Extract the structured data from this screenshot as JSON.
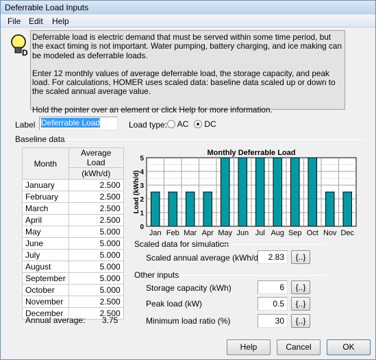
{
  "window": {
    "title": "Deferrable Load Inputs"
  },
  "menu": [
    "File",
    "Edit",
    "Help"
  ],
  "description": {
    "p1": "Deferrable load is electric demand that must be served within some time period, but the exact timing is not important. Water pumping, battery charging, and ice making can be modeled as deferrable loads.",
    "p2": "Enter 12 monthly values of average deferrable load, the storage capacity, and peak load. For calculations, HOMER uses scaled data: baseline data scaled up or down to the scaled annual average value.",
    "p3": "Hold the pointer over an element or click Help for more information."
  },
  "label": {
    "caption": "Label",
    "value": "Deferrable Load"
  },
  "load_type": {
    "caption": "Load type:",
    "ac": "AC",
    "dc": "DC",
    "selected": "DC"
  },
  "baseline": {
    "title": "Baseline data",
    "col_month": "Month",
    "col_avg": "Average Load",
    "col_unit": "(kWh/d)",
    "rows": [
      {
        "month": "January",
        "value": "2.500"
      },
      {
        "month": "February",
        "value": "2.500"
      },
      {
        "month": "March",
        "value": "2.500"
      },
      {
        "month": "April",
        "value": "2.500"
      },
      {
        "month": "May",
        "value": "5.000"
      },
      {
        "month": "June",
        "value": "5.000"
      },
      {
        "month": "July",
        "value": "5.000"
      },
      {
        "month": "August",
        "value": "5.000"
      },
      {
        "month": "September",
        "value": "5.000"
      },
      {
        "month": "October",
        "value": "5.000"
      },
      {
        "month": "November",
        "value": "2.500"
      },
      {
        "month": "December",
        "value": "2.500"
      }
    ],
    "annual_label": "Annual average:",
    "annual_value": "3.75"
  },
  "chart_data": {
    "type": "bar",
    "title": "Monthly Deferrable Load",
    "ylabel": "Load (kWh/d)",
    "xlabel": "",
    "ylim": [
      0,
      5
    ],
    "yticks": [
      "0",
      "1",
      "2",
      "3",
      "4",
      "5"
    ],
    "grid": true,
    "bar_color": "#009ba5",
    "categories": [
      "Jan",
      "Feb",
      "Mar",
      "Apr",
      "May",
      "Jun",
      "Jul",
      "Aug",
      "Sep",
      "Oct",
      "Nov",
      "Dec"
    ],
    "values": [
      2.5,
      2.5,
      2.5,
      2.5,
      5,
      5,
      5,
      5,
      5,
      5,
      2.5,
      2.5
    ]
  },
  "scaled": {
    "title": "Scaled data for simulation",
    "annual_label": "Scaled annual average (kWh/d)",
    "annual_value": "2.83",
    "sens": "{..}"
  },
  "other": {
    "title": "Other inputs",
    "storage_label": "Storage capacity (kWh)",
    "storage_value": "6",
    "peak_label": "Peak load (kW)",
    "peak_value": "0.5",
    "min_label": "Minimum load ratio (%)",
    "min_value": "30",
    "sens": "{..}"
  },
  "buttons": {
    "help": "Help",
    "cancel": "Cancel",
    "ok": "OK"
  }
}
